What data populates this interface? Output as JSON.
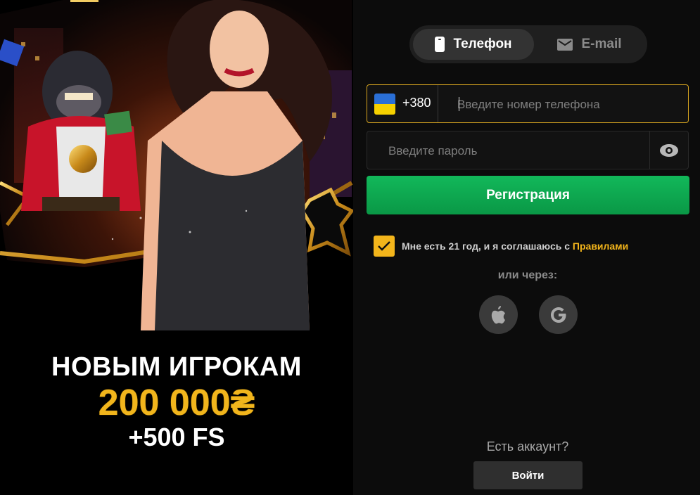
{
  "promo": {
    "title": "НОВЫМ ИГРОКАМ",
    "amount": "200 000₴",
    "free_spins": "+500 FS"
  },
  "tabs": [
    {
      "label": "Телефон",
      "icon": "phone-icon",
      "active": true
    },
    {
      "label": "E-mail",
      "icon": "mail-icon",
      "active": false
    }
  ],
  "phone": {
    "country_flag": "ukraine-flag-icon",
    "country_code": "+380",
    "placeholder": "Введите номер телефона"
  },
  "password": {
    "placeholder": "Введите пароль",
    "toggle_icon": "eye-icon"
  },
  "register_button": "Регистрация",
  "agreement": {
    "checked": true,
    "text": "Мне есть 21 год, и я соглашаюсь с ",
    "link": "Правилами"
  },
  "social": {
    "label": "или через:",
    "providers": [
      "apple-icon",
      "google-icon"
    ]
  },
  "login": {
    "prompt": "Есть аккаунт?",
    "button": "Войти"
  },
  "colors": {
    "accent": "#f3b51b",
    "register": "#0fa650",
    "background": "#0c0c0c"
  }
}
